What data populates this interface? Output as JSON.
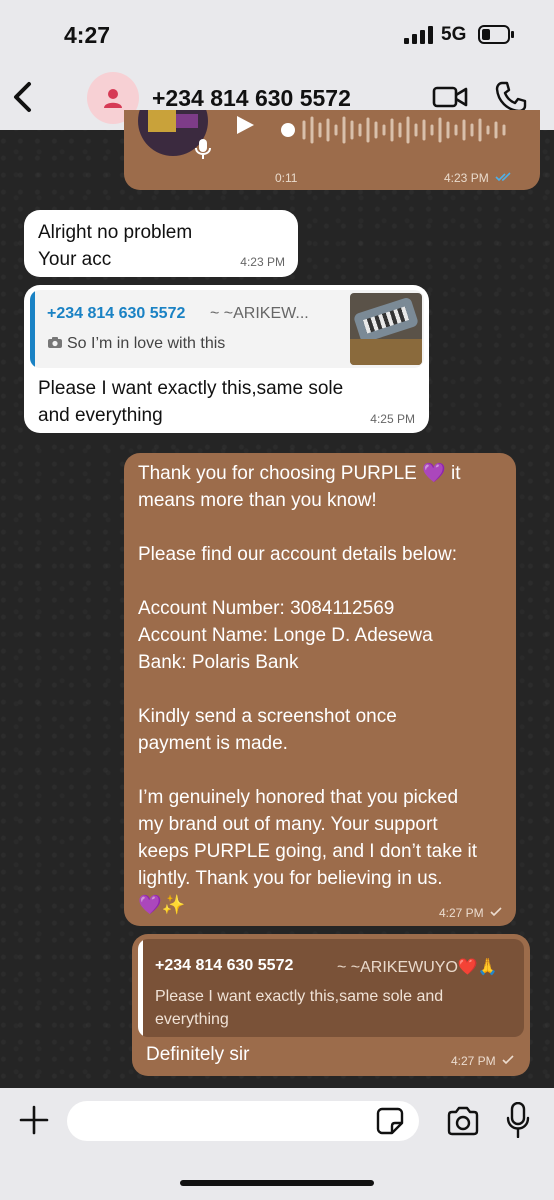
{
  "status_bar": {
    "time": "4:27",
    "network": "5G"
  },
  "header": {
    "contact_name": "+234 814 630 5572"
  },
  "voice_note": {
    "duration": "0:11",
    "time": "4:23 PM"
  },
  "messages": [
    {
      "direction": "incoming",
      "lines": [
        "Alright no problem",
        "Your acc"
      ],
      "time": "4:23 PM"
    },
    {
      "direction": "incoming",
      "quote": {
        "author": "+234 814 630 5572",
        "author_sub": "~ ~ARIKEW...",
        "text": "So I’m in love with this"
      },
      "lines": [
        "Please I want exactly this,same sole",
        "and everything"
      ],
      "time": "4:25 PM"
    },
    {
      "direction": "outgoing",
      "text": "Thank you for choosing PURPLE 💜 it\nmeans more than you know!\n\nPlease find our account details below:\n\nAccount Number: 3084112569\nAccount Name: Longe D. Adesewa\nBank: Polaris Bank\n\nKindly send a screenshot once\npayment is made.\n\nI’m genuinely honored that you picked\nmy brand out of many. Your support\nkeeps PURPLE going, and I don’t take it\nlightly. Thank you for believing in us.\n💜✨",
      "time": "4:27 PM"
    },
    {
      "direction": "outgoing",
      "quote": {
        "author": "+234 814 630 5572",
        "author_sub": "~ ~ARIKEWUYO❤️🙏",
        "text": "Please I want exactly this,same sole and everything"
      },
      "text": "Definitely sir",
      "time": "4:27 PM"
    }
  ],
  "colors": {
    "outgoing": "#9c6c4b",
    "incoming": "#ffffff",
    "quote_name": "#1a82c4",
    "bar": "#e9e9ec"
  },
  "icons": [
    "back-chevron-icon",
    "person-icon",
    "video-call-icon",
    "phone-icon",
    "plus-icon",
    "sticker-icon",
    "camera-icon",
    "mic-icon"
  ]
}
